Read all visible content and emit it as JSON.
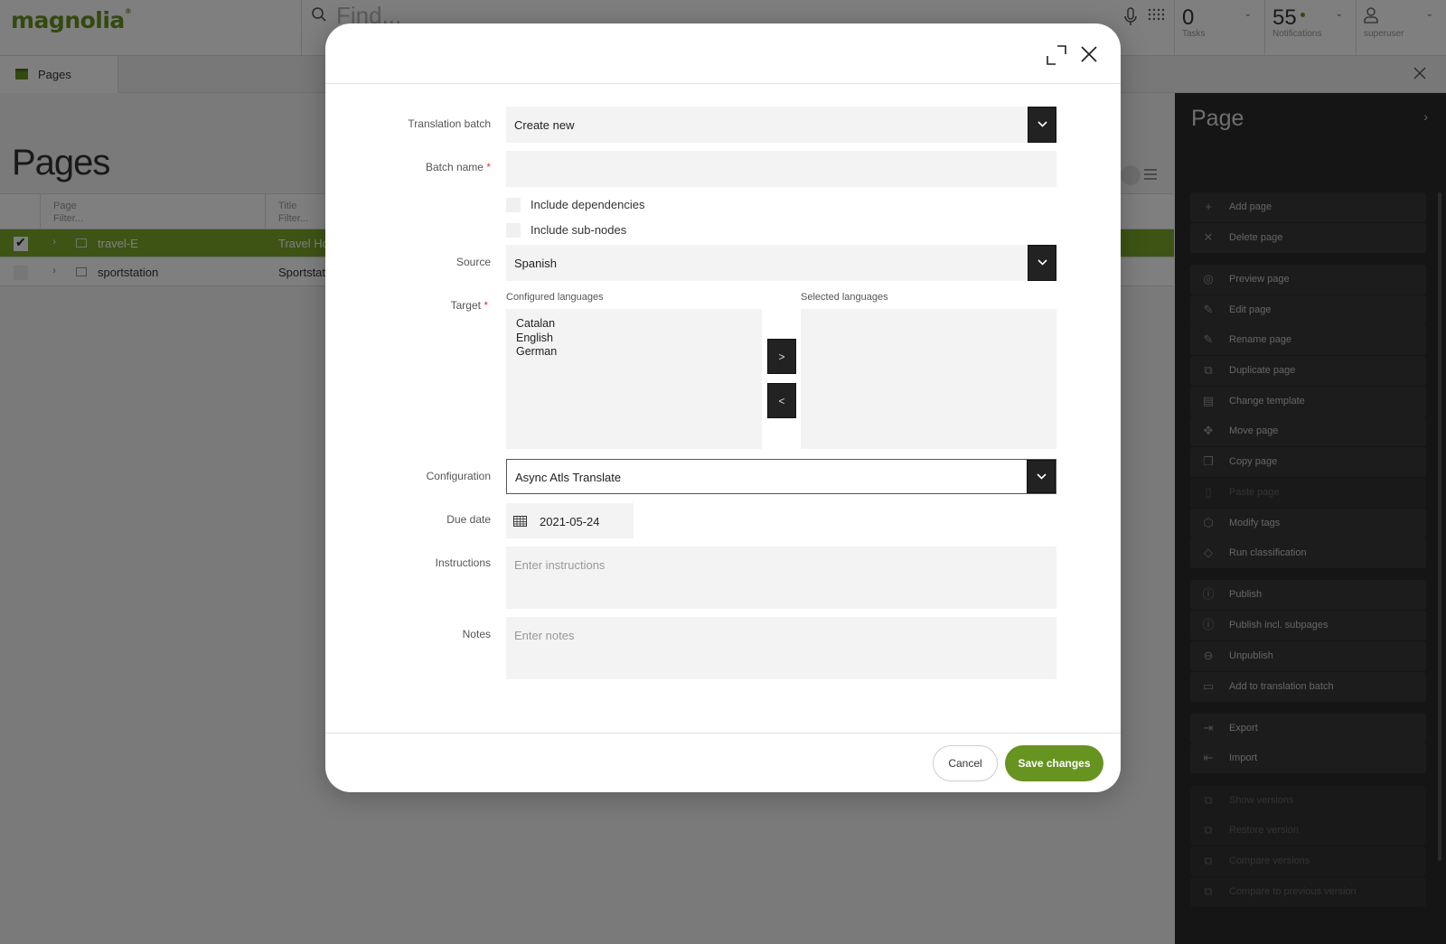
{
  "app": {
    "logo": "magnolia",
    "search_placeholder": "Find...",
    "tasks": {
      "count": "0",
      "label": "Tasks"
    },
    "notifications": {
      "count": "55",
      "label": "Notifications"
    },
    "user": {
      "label": "superuser"
    },
    "accent_color": "#679320"
  },
  "tabs": [
    {
      "label": "Pages"
    }
  ],
  "pages": {
    "title": "Pages",
    "columns": [
      {
        "label": "Page",
        "filter": "Filter..."
      },
      {
        "label": "Title",
        "filter": "Filter..."
      }
    ],
    "rows": [
      {
        "name": "travel-E",
        "title": "Travel Hor",
        "selected": true
      },
      {
        "name": "sportstation",
        "title": "Sportstati",
        "selected": false
      }
    ]
  },
  "action_panel": {
    "title": "Page",
    "groups": [
      [
        {
          "label": "Add page",
          "icon": "plus-icon",
          "disabled": false
        },
        {
          "label": "Delete page",
          "icon": "delete-icon",
          "disabled": false
        }
      ],
      [
        {
          "label": "Preview page",
          "icon": "eye-icon",
          "disabled": false
        },
        {
          "label": "Edit page",
          "icon": "pencil-icon",
          "disabled": false
        },
        {
          "label": "Rename page",
          "icon": "pencil-icon",
          "disabled": false
        },
        {
          "label": "Duplicate page",
          "icon": "duplicate-icon",
          "disabled": false
        },
        {
          "label": "Change template",
          "icon": "template-icon",
          "disabled": false
        },
        {
          "label": "Move page",
          "icon": "move-icon",
          "disabled": false
        },
        {
          "label": "Copy page",
          "icon": "copy-icon",
          "disabled": false
        },
        {
          "label": "Paste page",
          "icon": "clipboard-icon",
          "disabled": true
        },
        {
          "label": "Modify tags",
          "icon": "tag-icon",
          "disabled": false
        },
        {
          "label": "Run classification",
          "icon": "classify-icon",
          "disabled": false
        }
      ],
      [
        {
          "label": "Publish",
          "icon": "publish-icon",
          "disabled": false
        },
        {
          "label": "Publish incl. subpages",
          "icon": "publish-sub-icon",
          "disabled": false
        },
        {
          "label": "Unpublish",
          "icon": "unpublish-icon",
          "disabled": false
        },
        {
          "label": "Add to translation batch",
          "icon": "folder-add-icon",
          "disabled": false
        }
      ],
      [
        {
          "label": "Export",
          "icon": "export-icon",
          "disabled": false
        },
        {
          "label": "Import",
          "icon": "import-icon",
          "disabled": false
        }
      ],
      [
        {
          "label": "Show versions",
          "icon": "versions-icon",
          "disabled": true
        },
        {
          "label": "Restore version",
          "icon": "versions-icon",
          "disabled": true
        },
        {
          "label": "Compare versions",
          "icon": "versions-icon",
          "disabled": true
        },
        {
          "label": "Compare to previous version",
          "icon": "versions-icon",
          "disabled": true
        }
      ]
    ]
  },
  "dialog": {
    "fields": {
      "translation_batch": {
        "label": "Translation batch",
        "value": "Create new"
      },
      "batch_name": {
        "label": "Batch name",
        "required_mark": "*",
        "value": ""
      },
      "include_dependencies": {
        "label": "Include dependencies",
        "checked": false
      },
      "include_subnodes": {
        "label": "Include sub-nodes",
        "checked": false
      },
      "source": {
        "label": "Source",
        "value": "Spanish"
      },
      "target": {
        "label": "Target",
        "required_mark": "*",
        "configured_label": "Configured languages",
        "selected_label": "Selected languages",
        "configured": [
          "Catalan",
          "English",
          "German"
        ],
        "selected": [],
        "add_label": ">",
        "remove_label": "<"
      },
      "configuration": {
        "label": "Configuration",
        "value": "Async Atls Translate"
      },
      "due_date": {
        "label": "Due date",
        "value": "2021-05-24"
      },
      "instructions": {
        "label": "Instructions",
        "placeholder": "Enter instructions",
        "value": ""
      },
      "notes": {
        "label": "Notes",
        "placeholder": "Enter notes",
        "value": ""
      }
    },
    "cancel_label": "Cancel",
    "save_label": "Save changes"
  }
}
